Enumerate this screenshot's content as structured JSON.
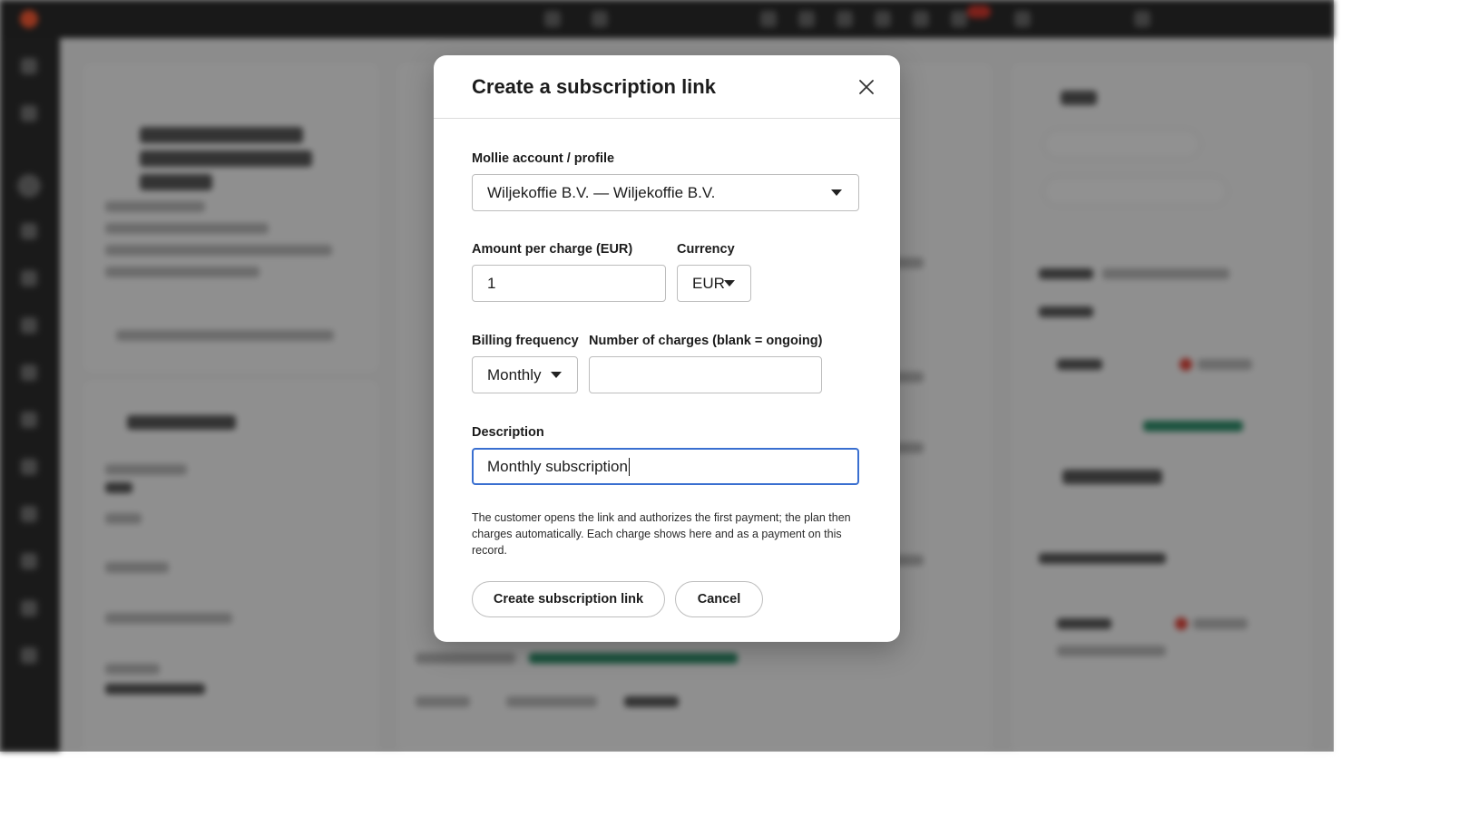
{
  "modal": {
    "title": "Create a subscription link",
    "close_icon": "close-icon",
    "account": {
      "label": "Mollie account / profile",
      "value": "Wiljekoffie B.V. — Wiljekoffie B.V."
    },
    "amount": {
      "label": "Amount per charge (EUR)",
      "value": "1"
    },
    "currency": {
      "label": "Currency",
      "value": "EUR"
    },
    "billing_frequency": {
      "label": "Billing frequency",
      "value": "Monthly"
    },
    "number_of_charges": {
      "label": "Number of charges (blank = ongoing)",
      "value": ""
    },
    "description": {
      "label": "Description",
      "value": "Monthly subscription"
    },
    "help_text": "The customer opens the link and authorizes the first payment; the plan then charges automatically. Each charge shows here and as a payment on this record.",
    "buttons": {
      "create": "Create subscription link",
      "cancel": "Cancel"
    }
  },
  "colors": {
    "overlay": "#6b6b6b",
    "focus_border": "#3a6fd0",
    "topbar": "#2b2b2b",
    "brand_logo": "#ff5c35"
  }
}
